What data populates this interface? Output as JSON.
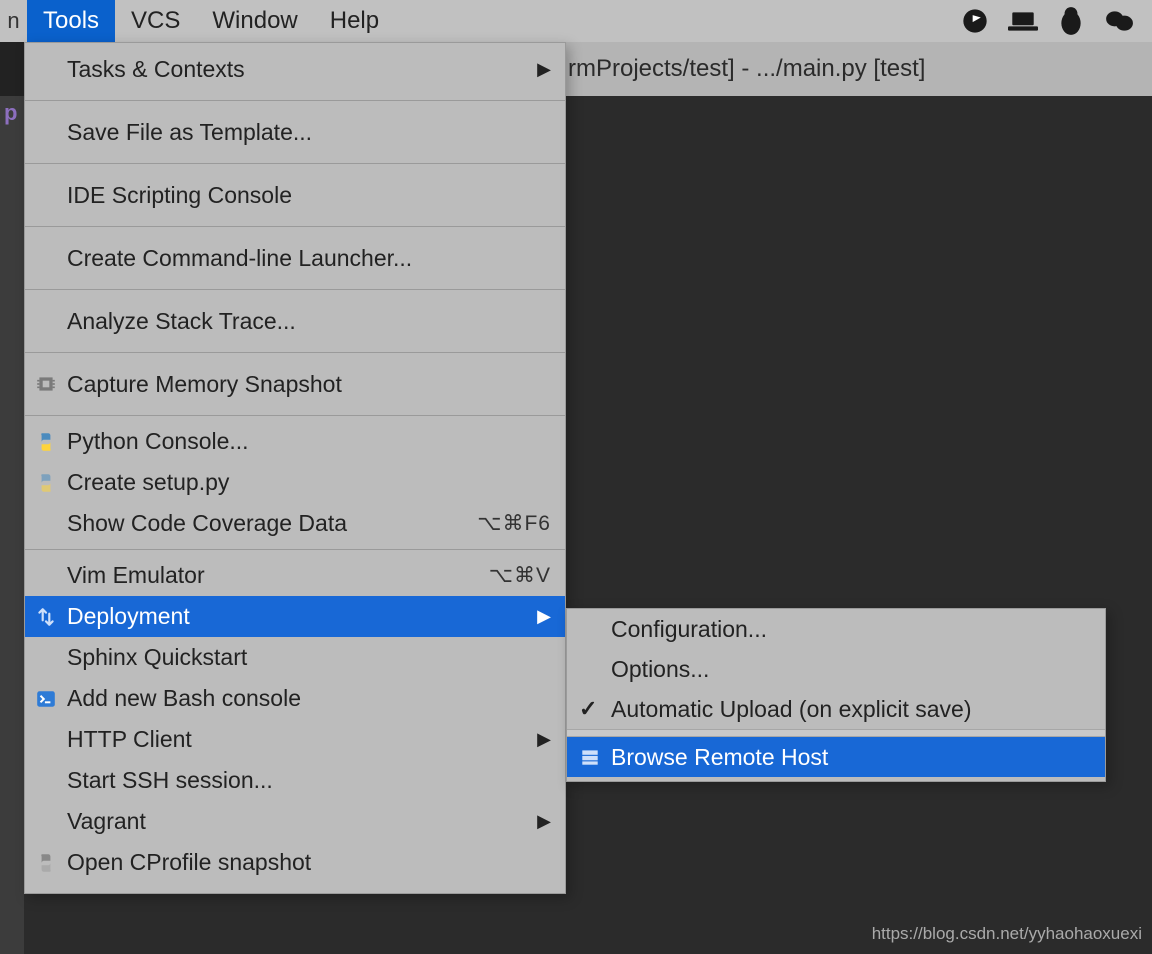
{
  "menubar": {
    "edge_char": "n",
    "items": [
      "Tools",
      "VCS",
      "Window",
      "Help"
    ],
    "active_index": 0
  },
  "title_fragment": "rmProjects/test] - .../main.py [test]",
  "left_panel_char": "p",
  "dropdown": {
    "items": [
      {
        "label": "Tasks & Contexts",
        "submenu": true,
        "tall": true
      },
      {
        "sep": true
      },
      {
        "label": "Save File as Template...",
        "tall": true
      },
      {
        "sep": true
      },
      {
        "label": "IDE Scripting Console",
        "tall": true
      },
      {
        "sep": true
      },
      {
        "label": "Create Command-line Launcher...",
        "tall": true
      },
      {
        "sep": true
      },
      {
        "label": "Analyze Stack Trace...",
        "tall": true
      },
      {
        "sep": true
      },
      {
        "label": "Capture Memory Snapshot",
        "icon": "chip",
        "tall": true
      },
      {
        "sep": true
      },
      {
        "label": "Python Console...",
        "icon": "python"
      },
      {
        "label": "Create setup.py",
        "icon": "python-dim"
      },
      {
        "label": "Show Code Coverage Data",
        "shortcut": "⌥⌘F6"
      },
      {
        "sep": true
      },
      {
        "label": "Vim Emulator",
        "shortcut": "⌥⌘V"
      },
      {
        "label": "Deployment",
        "icon": "updown",
        "submenu": true,
        "selected": true
      },
      {
        "label": "Sphinx Quickstart"
      },
      {
        "label": "Add new Bash console",
        "icon": "terminal"
      },
      {
        "label": "HTTP Client",
        "submenu": true
      },
      {
        "label": "Start SSH session..."
      },
      {
        "label": "Vagrant",
        "submenu": true
      },
      {
        "label": "Open CProfile snapshot",
        "icon": "python-grey"
      }
    ]
  },
  "submenu": {
    "items": [
      {
        "label": "Configuration..."
      },
      {
        "label": "Options..."
      },
      {
        "label": "Automatic Upload (on explicit save)",
        "checked": true
      },
      {
        "strip": true
      },
      {
        "label": "Browse Remote Host",
        "icon": "server",
        "selected": true
      }
    ]
  },
  "watermark": "https://blog.csdn.net/yyhaohaoxuexi"
}
